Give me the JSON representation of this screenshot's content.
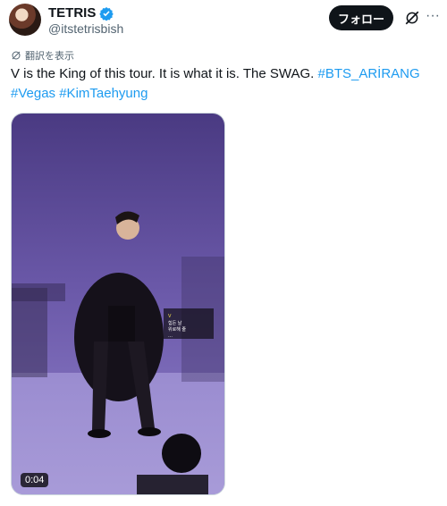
{
  "author": {
    "display_name": "TETRIS",
    "handle": "@itstetrisbish",
    "verified": true
  },
  "actions": {
    "follow_label": "フォロー",
    "grok_icon": "grok-icon",
    "more_icon": "more-icon"
  },
  "translate": {
    "label": "翻訳を表示",
    "icon": "translate-icon"
  },
  "tweet": {
    "text": "V is the King of this tour. It is what it is. The SWAG. ",
    "hashtags": [
      "#BTS_ARİRANG",
      "#Vegas",
      "#KimTaehyung"
    ]
  },
  "media": {
    "type": "video",
    "duration": "0:04",
    "screen_caption_lines": [
      "V",
      "힘든 날",
      "위로해 줄",
      "…"
    ]
  },
  "colors": {
    "accent": "#1d9bf0",
    "text": "#0f1419",
    "secondary": "#536471",
    "stage_purple": "#6a52a8"
  }
}
